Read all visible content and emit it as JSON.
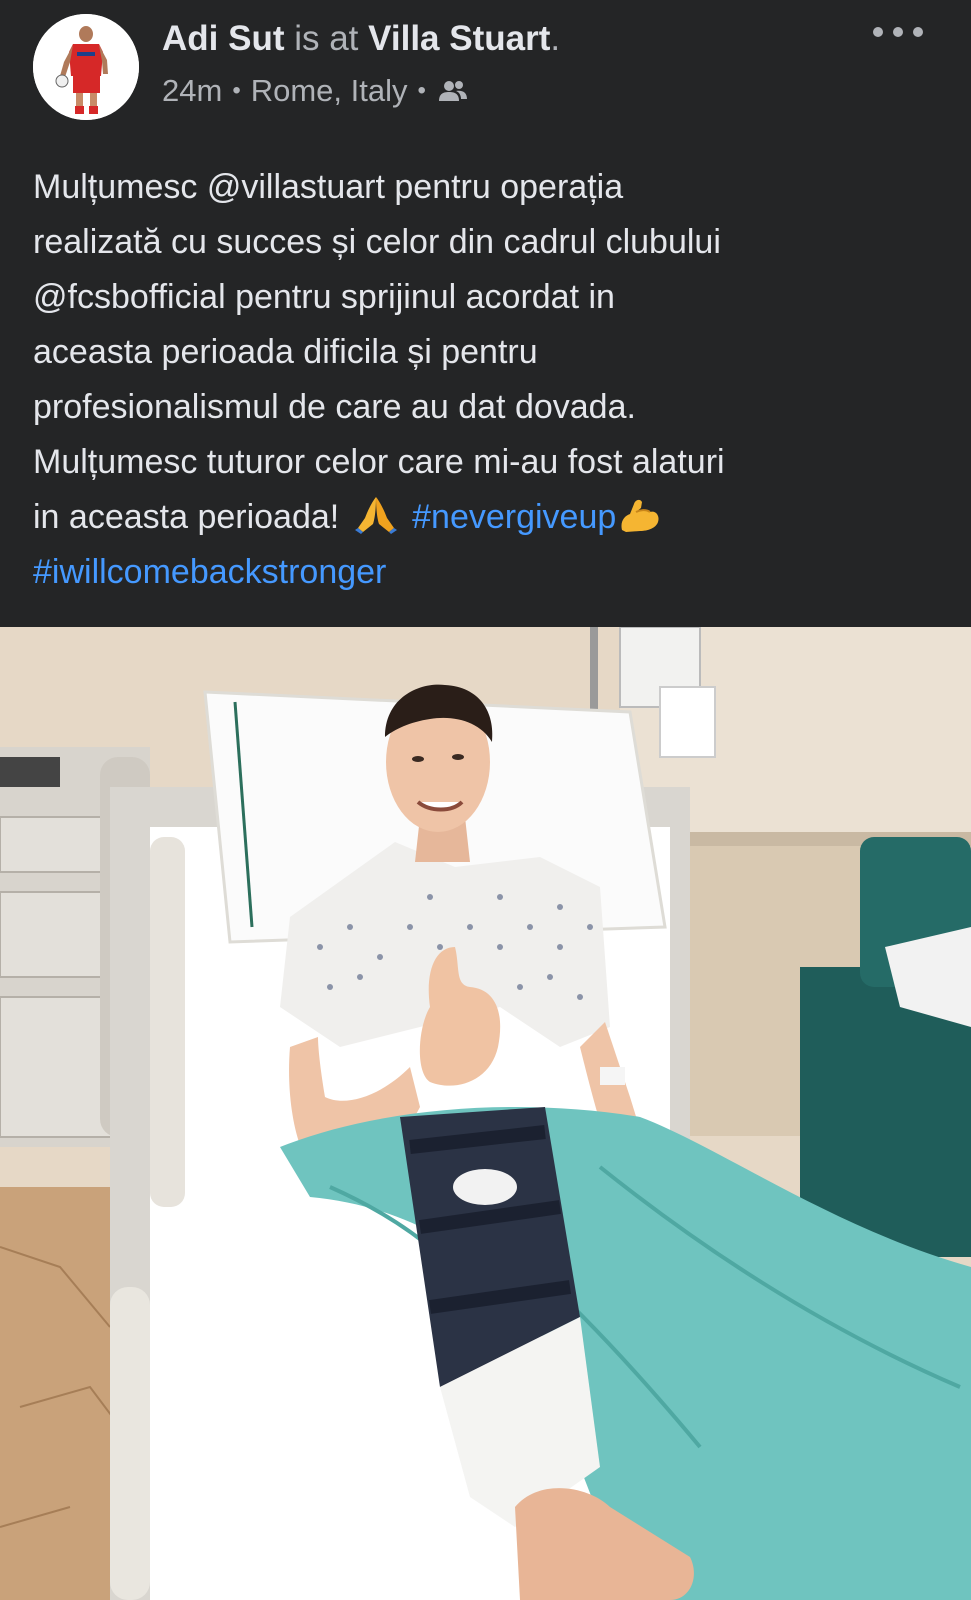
{
  "post": {
    "author_name": "Adi Sut",
    "connector": "is at",
    "place": "Villa Stuart",
    "period": ".",
    "time": "24m",
    "location": "Rome, Italy",
    "separator": "•",
    "audience_icon": "friends-icon",
    "more_icon": "more-options-icon",
    "body_lines": [
      "Mulțumesc @villastuart pentru operația",
      "realizată cu succes și celor din cadrul clubului",
      "@fcsbofficial pentru sprijinul acordat in",
      "aceasta perioada dificila și pentru",
      "profesionalismul de care au dat dovada.",
      "Mulțumesc tuturor celor care mi-au fost alaturi"
    ],
    "last_line_text": "in aceasta perioada!",
    "pray_emoji": "🙏",
    "muscle_emoji": "💪",
    "hashtag_1": "#nevergiveup",
    "hashtag_2": "#iwillcomebackstronger"
  },
  "colors": {
    "background": "#242526",
    "primary_text": "#e4e6eb",
    "secondary_text": "#b0b3b8",
    "hashtag": "#4599ff"
  },
  "photo": {
    "description_icon": "post-photo"
  }
}
